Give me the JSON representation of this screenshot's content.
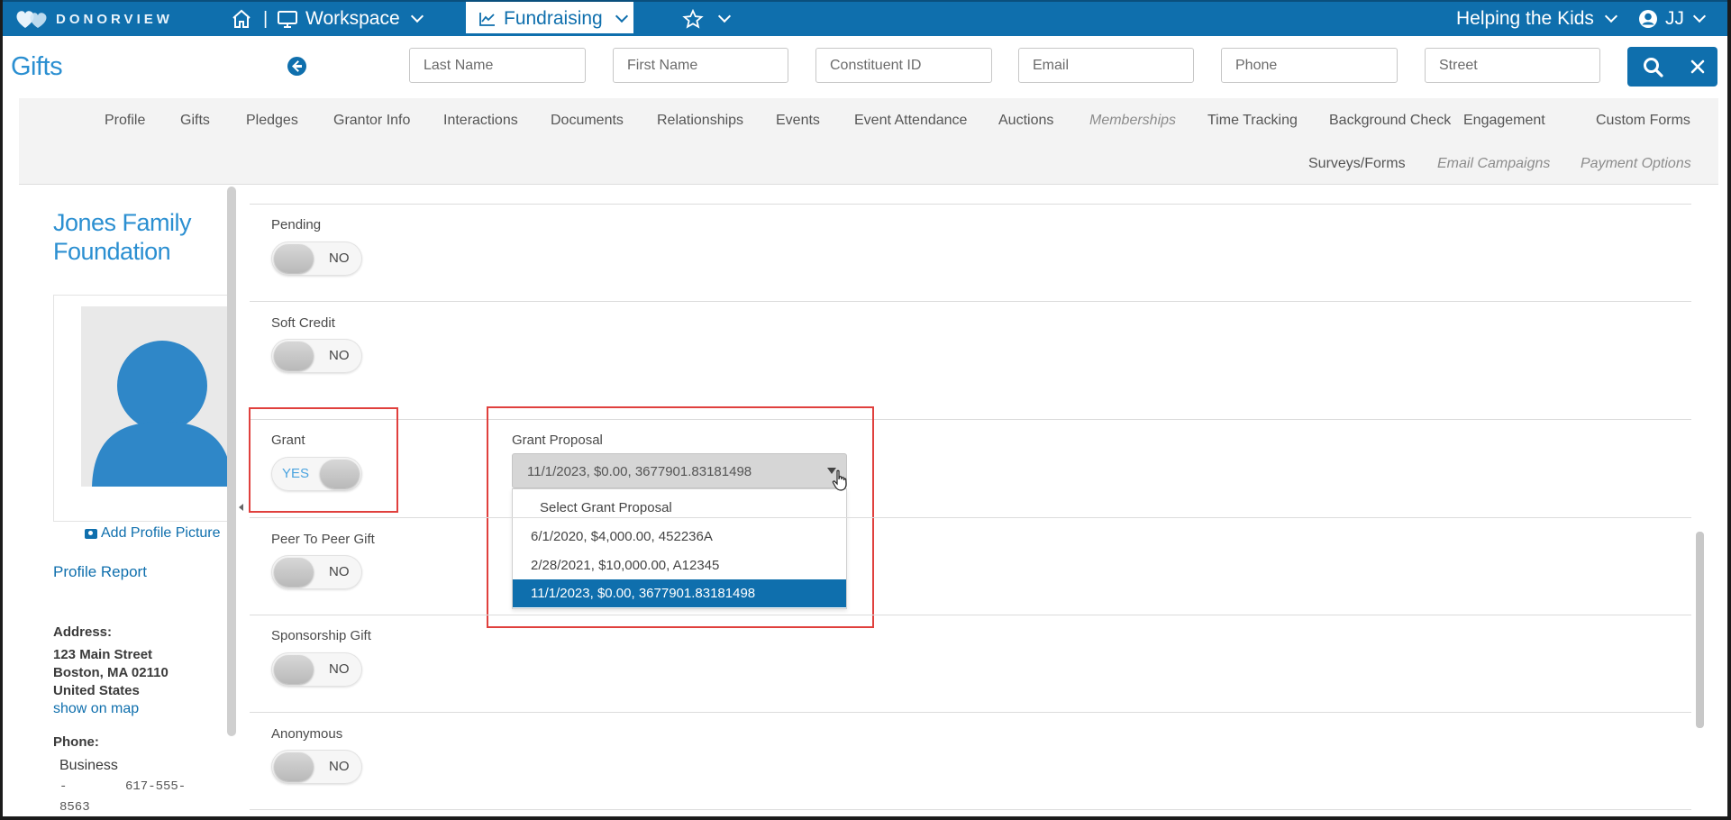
{
  "topbar": {
    "logo_text": "DONORVIEW",
    "separator": "|",
    "workspace_label": "Workspace",
    "fundraising_label": "Fundraising",
    "org_label": "Helping the Kids",
    "user_initials": "JJ"
  },
  "header": {
    "title": "Gifts",
    "search": {
      "last_name": "Last Name",
      "first_name": "First Name",
      "constituent_id": "Constituent ID",
      "email": "Email",
      "phone": "Phone",
      "street": "Street"
    }
  },
  "tabs": {
    "row1": [
      "Profile",
      "Gifts",
      "Pledges",
      "Grantor Info",
      "Interactions",
      "Documents",
      "Relationships",
      "Events",
      "Event Attendance",
      "Auctions",
      "Memberships",
      "Time Tracking",
      "Background Check",
      "Engagement",
      "Custom Forms"
    ],
    "row2": [
      "Surveys/Forms",
      "Email Campaigns",
      "Payment Options"
    ]
  },
  "sidebar": {
    "org_name": "Jones Family Foundation",
    "add_picture": "Add Profile Picture",
    "profile_report": "Profile Report",
    "address_label": "Address:",
    "address_lines": [
      "123 Main Street",
      "Boston, MA 02110",
      "United States"
    ],
    "show_on_map": "show on map",
    "phone_label": "Phone:",
    "phone_type": "Business",
    "phone_number_parts": [
      "-",
      "617-555-",
      "8563"
    ]
  },
  "form": {
    "pending": {
      "label": "Pending",
      "toggle": "NO"
    },
    "soft_credit": {
      "label": "Soft Credit",
      "toggle": "NO"
    },
    "grant": {
      "label": "Grant",
      "toggle": "YES"
    },
    "peer_to_peer": {
      "label": "Peer To Peer Gift",
      "toggle": "NO"
    },
    "sponsorship": {
      "label": "Sponsorship Gift",
      "toggle": "NO"
    },
    "anonymous": {
      "label": "Anonymous",
      "toggle": "NO"
    },
    "grant_proposal": {
      "label": "Grant Proposal",
      "selected": "11/1/2023, $0.00, 3677901.83181498",
      "options": [
        "Select Grant Proposal",
        "6/1/2020, $4,000.00, 452236A",
        "2/28/2021, $10,000.00, A12345",
        "11/1/2023, $0.00, 3677901.83181498"
      ]
    }
  },
  "colors": {
    "brand": "#0f6fad",
    "link": "#2b8fd1",
    "highlight": "#e0403d"
  }
}
